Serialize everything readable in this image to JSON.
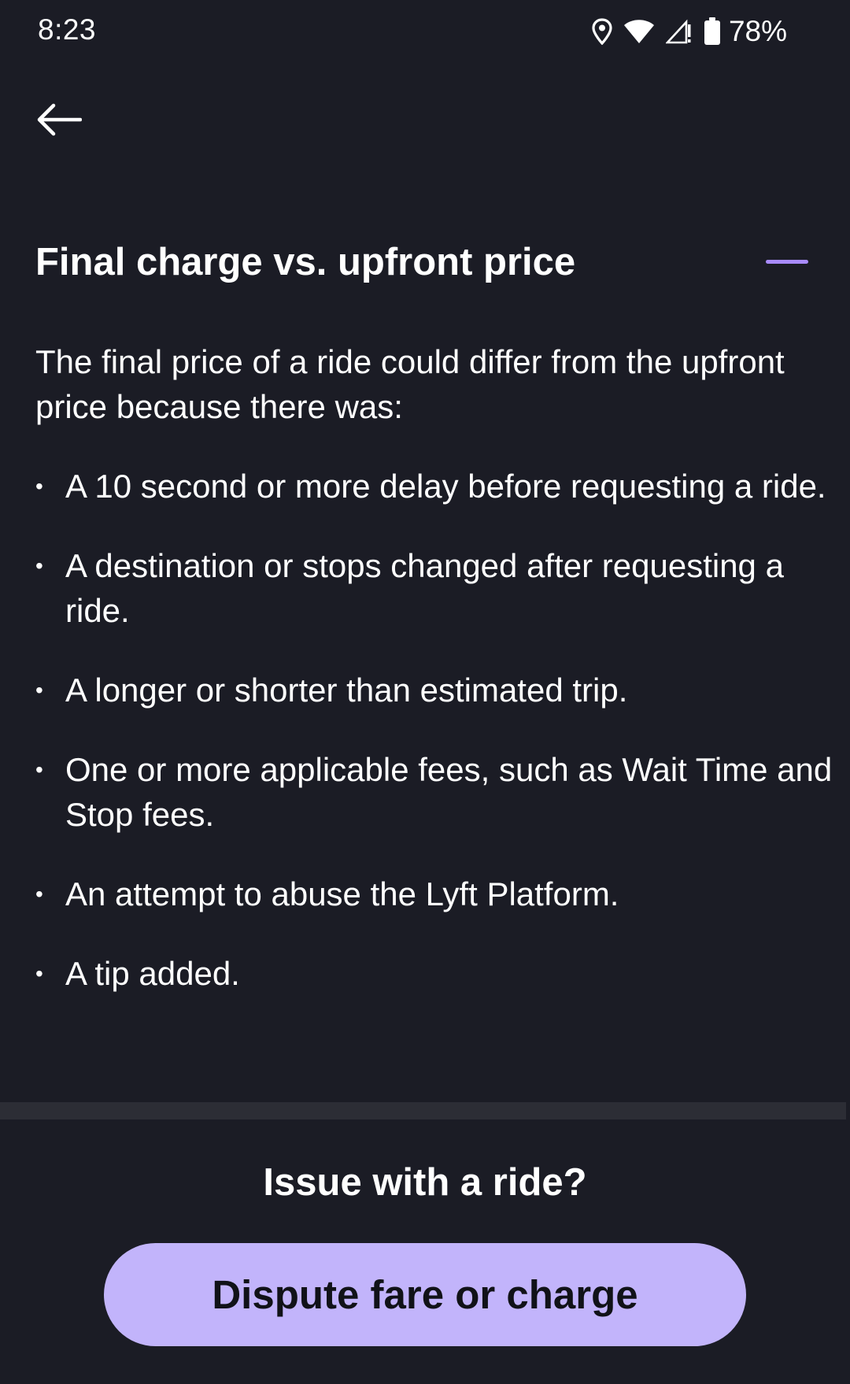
{
  "status_bar": {
    "time": "8:23",
    "battery_percent": "78%",
    "icons": [
      "location-icon",
      "wifi-icon",
      "signal-icon",
      "battery-icon"
    ]
  },
  "nav": {
    "back_icon": "arrow-left-icon"
  },
  "section": {
    "title": "Final charge vs. upfront price",
    "toggle_icon": "minus-icon",
    "accent_color": "#a98bff",
    "intro": "The final price of a ride could differ from the upfront price because there was:",
    "reasons": [
      "A 10 second or more delay before requesting a ride.",
      "A destination or stops changed after requesting a ride.",
      "A longer or shorter than estimated trip.",
      "One or more applicable fees, such as Wait Time and Stop fees.",
      "An attempt to abuse the Lyft Platform.",
      "A tip added."
    ]
  },
  "footer": {
    "heading": "Issue with a ride?",
    "button_label": "Dispute fare or charge",
    "button_color": "#c2b4fb"
  },
  "colors": {
    "background": "#1b1c25",
    "divider": "#2c2d35",
    "text": "#ffffff"
  }
}
